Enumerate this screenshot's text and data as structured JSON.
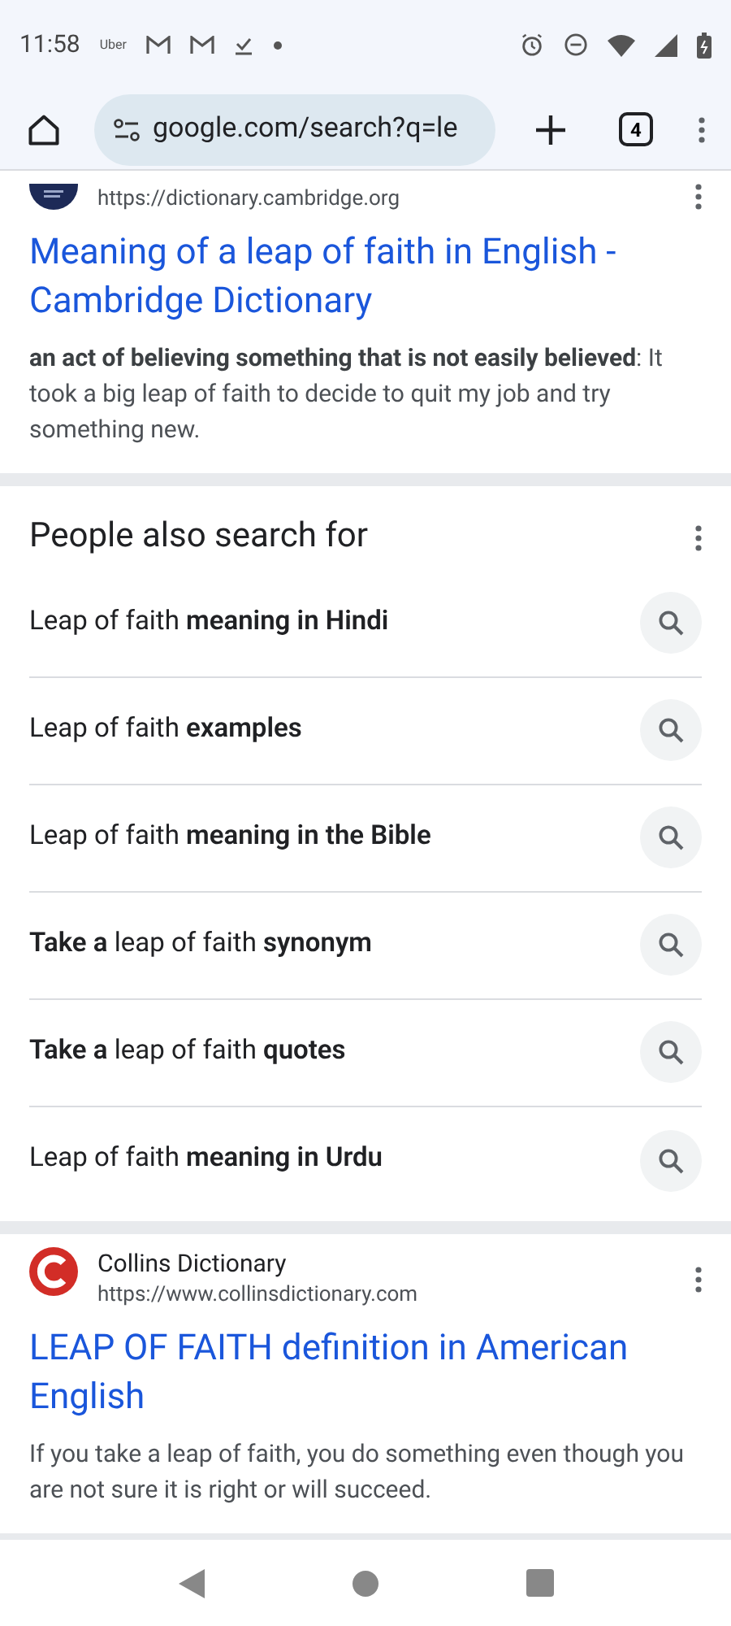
{
  "status_bar": {
    "time": "11:58",
    "notification_text": "Uber"
  },
  "toolbar": {
    "url": "google.com/search?q=le",
    "tab_count": "4"
  },
  "results": [
    {
      "url": "https://dictionary.cambridge.org",
      "title": "Meaning of a leap of faith in English - Cambridge Dictionary",
      "snippet": "**an act of believing something that is not easily believed**: It took a big leap of faith to decide to quit my job and try something new.",
      "kind": "cambridge"
    }
  ],
  "people_also_search": {
    "heading": "People also search for",
    "items": [
      "Leap of faith **meaning in Hindi**",
      "Leap of faith **examples**",
      "Leap of faith **meaning in the Bible**",
      "**Take a** leap of faith **synonym**",
      "**Take a** leap of faith **quotes**",
      "Leap of faith **meaning in Urdu**"
    ]
  },
  "results_after": [
    {
      "site_name": "Collins Dictionary",
      "url": "https://www.collinsdictionary.com",
      "title": "LEAP OF FAITH definition in American English",
      "snippet": "If you take a leap of faith, you do something even though you are not sure it is right or will succeed.",
      "kind": "collins"
    }
  ]
}
